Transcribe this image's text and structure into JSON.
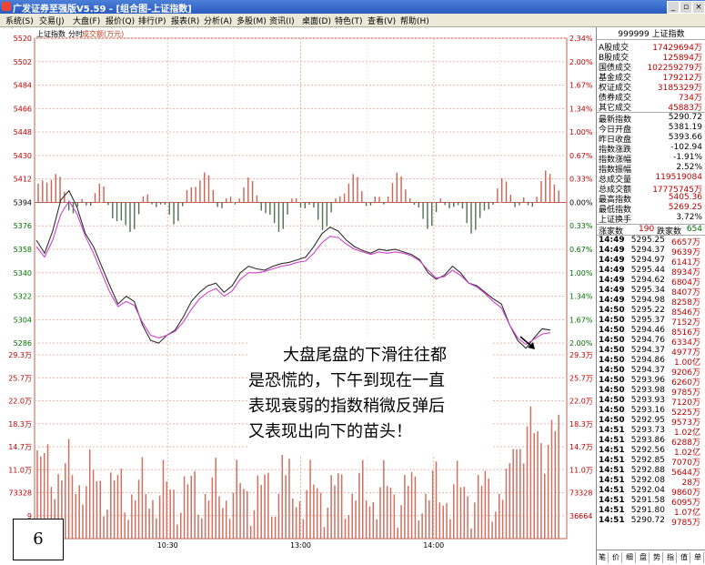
{
  "window": {
    "title": "广发证券至强版V5.59 - [组合图-上证指数]",
    "buttons": [
      "_",
      "▫",
      "×"
    ]
  },
  "menu": [
    "系统(S)",
    "交易(J)",
    "大盘(F)",
    "报价(Q)",
    "排行(P)",
    "报表(R)",
    "分析(A)",
    "多股(M)",
    "资讯(I)",
    "桌面(D)",
    "特色(T)",
    "查看(V)",
    "帮助(H)"
  ],
  "chart": {
    "header": {
      "name": "上证指数",
      "period": "分时",
      "measure": "成交额(万元)"
    },
    "price_axis_left": [
      "5520",
      "5502",
      "5484",
      "5466",
      "5448",
      "5430",
      "5412",
      "5394",
      "5376",
      "5358",
      "5340",
      "5322",
      "5304",
      "5286"
    ],
    "pct_axis_right": [
      "2.34%",
      "2.00%",
      "1.67%",
      "1.34%",
      "1.00%",
      "0.67%",
      "0.33%",
      "0.00%",
      "0.33%",
      "0.67%",
      "1.00%",
      "1.34%",
      "1.67%",
      "2.00%"
    ],
    "volume_axis": [
      "29.3万",
      "25.7万",
      "22.0万",
      "18.3万",
      "14.7万",
      "11.0万",
      "73328",
      "36664"
    ],
    "volume_axis_left_top": [
      "29.3万",
      "25.7万",
      "22.0万",
      "18.3万",
      "14.7万",
      "11.0万",
      "73328",
      "9"
    ],
    "time_labels": [
      "10:30",
      "13:00",
      "14:00"
    ],
    "colors": {
      "index_line": "#303030",
      "avg_line": "#cc44cc",
      "up_bar": "#d06050",
      "down_bar": "#507050",
      "grid": "#d08070"
    }
  },
  "chart_data": {
    "type": "line",
    "title": "上证指数 分时",
    "ylabel": "",
    "ylim": [
      5276,
      5520
    ],
    "series": [
      {
        "name": "上证指数",
        "values": [
          5365,
          5355,
          5372,
          5396,
          5403,
          5390,
          5370,
          5360,
          5345,
          5330,
          5316,
          5322,
          5318,
          5300,
          5288,
          5286,
          5292,
          5296,
          5306,
          5318,
          5325,
          5330,
          5332,
          5325,
          5330,
          5340,
          5345,
          5343,
          5342,
          5345,
          5347,
          5348,
          5350,
          5352,
          5360,
          5370,
          5375,
          5372,
          5365,
          5360,
          5357,
          5355,
          5358,
          5357,
          5358,
          5356,
          5354,
          5350,
          5340,
          5335,
          5338,
          5345,
          5340,
          5332,
          5330,
          5325,
          5320,
          5316,
          5300,
          5288,
          5282,
          5290,
          5297,
          5296
        ]
      },
      {
        "name": "",
        "values": [
          5360,
          5352,
          5365,
          5385,
          5395,
          5385,
          5368,
          5355,
          5340,
          5325,
          5314,
          5318,
          5315,
          5302,
          5292,
          5290,
          5292,
          5295,
          5302,
          5312,
          5320,
          5325,
          5328,
          5322,
          5326,
          5335,
          5340,
          5340,
          5341,
          5343,
          5345,
          5346,
          5348,
          5349,
          5355,
          5363,
          5368,
          5367,
          5362,
          5358,
          5356,
          5354,
          5356,
          5355,
          5356,
          5355,
          5353,
          5349,
          5342,
          5336,
          5337,
          5342,
          5338,
          5332,
          5329,
          5324,
          5318,
          5313,
          5300,
          5290,
          5285,
          5289,
          5293,
          5294
        ]
      }
    ]
  },
  "panel": {
    "header": "999999 上证指数",
    "turnover": [
      {
        "label": "A股成交",
        "value": "17429694万"
      },
      {
        "label": "B股成交",
        "value": "125894万"
      },
      {
        "label": "国债成交",
        "value": "102259279万"
      },
      {
        "label": "基金成交",
        "value": "179212万"
      },
      {
        "label": "权证成交",
        "value": "3185329万"
      },
      {
        "label": "债券成交",
        "value": "734万"
      },
      {
        "label": "其它成交",
        "value": "45883万"
      }
    ],
    "stats": [
      {
        "label": "最新指数",
        "value": "5290.72",
        "cls": "blk"
      },
      {
        "label": "今日开盘",
        "value": "5381.19",
        "cls": "blk"
      },
      {
        "label": "昨日收盘",
        "value": "5393.66",
        "cls": "blk"
      },
      {
        "label": "指数涨跌",
        "value": "-102.94",
        "cls": "blk"
      },
      {
        "label": "指数涨幅",
        "value": "-1.91%",
        "cls": "blk"
      },
      {
        "label": "指数振幅",
        "value": "2.52%",
        "cls": "blk"
      },
      {
        "label": "总成交量",
        "value": "119519084",
        "cls": "red"
      },
      {
        "label": "总成交额",
        "value": "17775745万",
        "cls": "red"
      },
      {
        "label": "最高指数",
        "value": "5405.36",
        "cls": "red"
      },
      {
        "label": "最低指数",
        "value": "5269.25",
        "cls": "red"
      },
      {
        "label": "上证换手",
        "value": "3.72%",
        "cls": "blk"
      }
    ],
    "breadth": {
      "up_label": "涨家数",
      "up_value": "190",
      "down_label": "跌家数",
      "down_value": "654"
    },
    "ticks": [
      {
        "time": "14:49",
        "price": "5295.25",
        "vol": "6657万"
      },
      {
        "time": "14:49",
        "price": "5294.37",
        "vol": "9639万"
      },
      {
        "time": "14:49",
        "price": "5294.97",
        "vol": "6141万"
      },
      {
        "time": "14:49",
        "price": "5295.44",
        "vol": "8934万"
      },
      {
        "time": "14:49",
        "price": "5294.62",
        "vol": "6804万"
      },
      {
        "time": "14:49",
        "price": "5295.34",
        "vol": "8407万"
      },
      {
        "time": "14:49",
        "price": "5294.98",
        "vol": "8258万"
      },
      {
        "time": "14:50",
        "price": "5295.22",
        "vol": "8546万"
      },
      {
        "time": "14:50",
        "price": "5295.37",
        "vol": "7152万"
      },
      {
        "time": "14:50",
        "price": "5294.46",
        "vol": "8516万"
      },
      {
        "time": "14:50",
        "price": "5294.76",
        "vol": "6334万"
      },
      {
        "time": "14:50",
        "price": "5294.37",
        "vol": "4977万"
      },
      {
        "time": "14:50",
        "price": "5294.86",
        "vol": "1.00亿"
      },
      {
        "time": "14:50",
        "price": "5294.37",
        "vol": "9206万"
      },
      {
        "time": "14:50",
        "price": "5293.96",
        "vol": "6260万"
      },
      {
        "time": "14:50",
        "price": "5293.98",
        "vol": "9785万"
      },
      {
        "time": "14:50",
        "price": "5293.93",
        "vol": "7120万"
      },
      {
        "time": "14:50",
        "price": "5293.16",
        "vol": "5225万"
      },
      {
        "time": "14:50",
        "price": "5292.95",
        "vol": "9573万"
      },
      {
        "time": "14:51",
        "price": "5293.73",
        "vol": "1.02亿"
      },
      {
        "time": "14:51",
        "price": "5293.86",
        "vol": "6288万"
      },
      {
        "time": "14:51",
        "price": "5292.56",
        "vol": "1.02亿"
      },
      {
        "time": "14:51",
        "price": "5292.85",
        "vol": "7070万"
      },
      {
        "time": "14:51",
        "price": "5292.88",
        "vol": "5644万"
      },
      {
        "time": "14:51",
        "price": "5292.08",
        "vol": "28万"
      },
      {
        "time": "14:51",
        "price": "5292.04",
        "vol": "9860万"
      },
      {
        "time": "14:51",
        "price": "5291.58",
        "vol": "6095万"
      },
      {
        "time": "14:51",
        "price": "5291.80",
        "vol": "1.07亿"
      },
      {
        "time": "14:51",
        "price": "5290.72",
        "vol": "9785万"
      }
    ],
    "tabs": [
      "笔",
      "价",
      "细",
      "盘",
      "势",
      "指",
      "值",
      "单"
    ]
  },
  "annotation": {
    "lines": [
      "大盘尾盘的下滑往往都",
      "是恐慌的，下午到现在一直",
      "表现衰弱的指数稍微反弹后",
      "又表现出向下的苗头！"
    ]
  },
  "page_number": "6"
}
